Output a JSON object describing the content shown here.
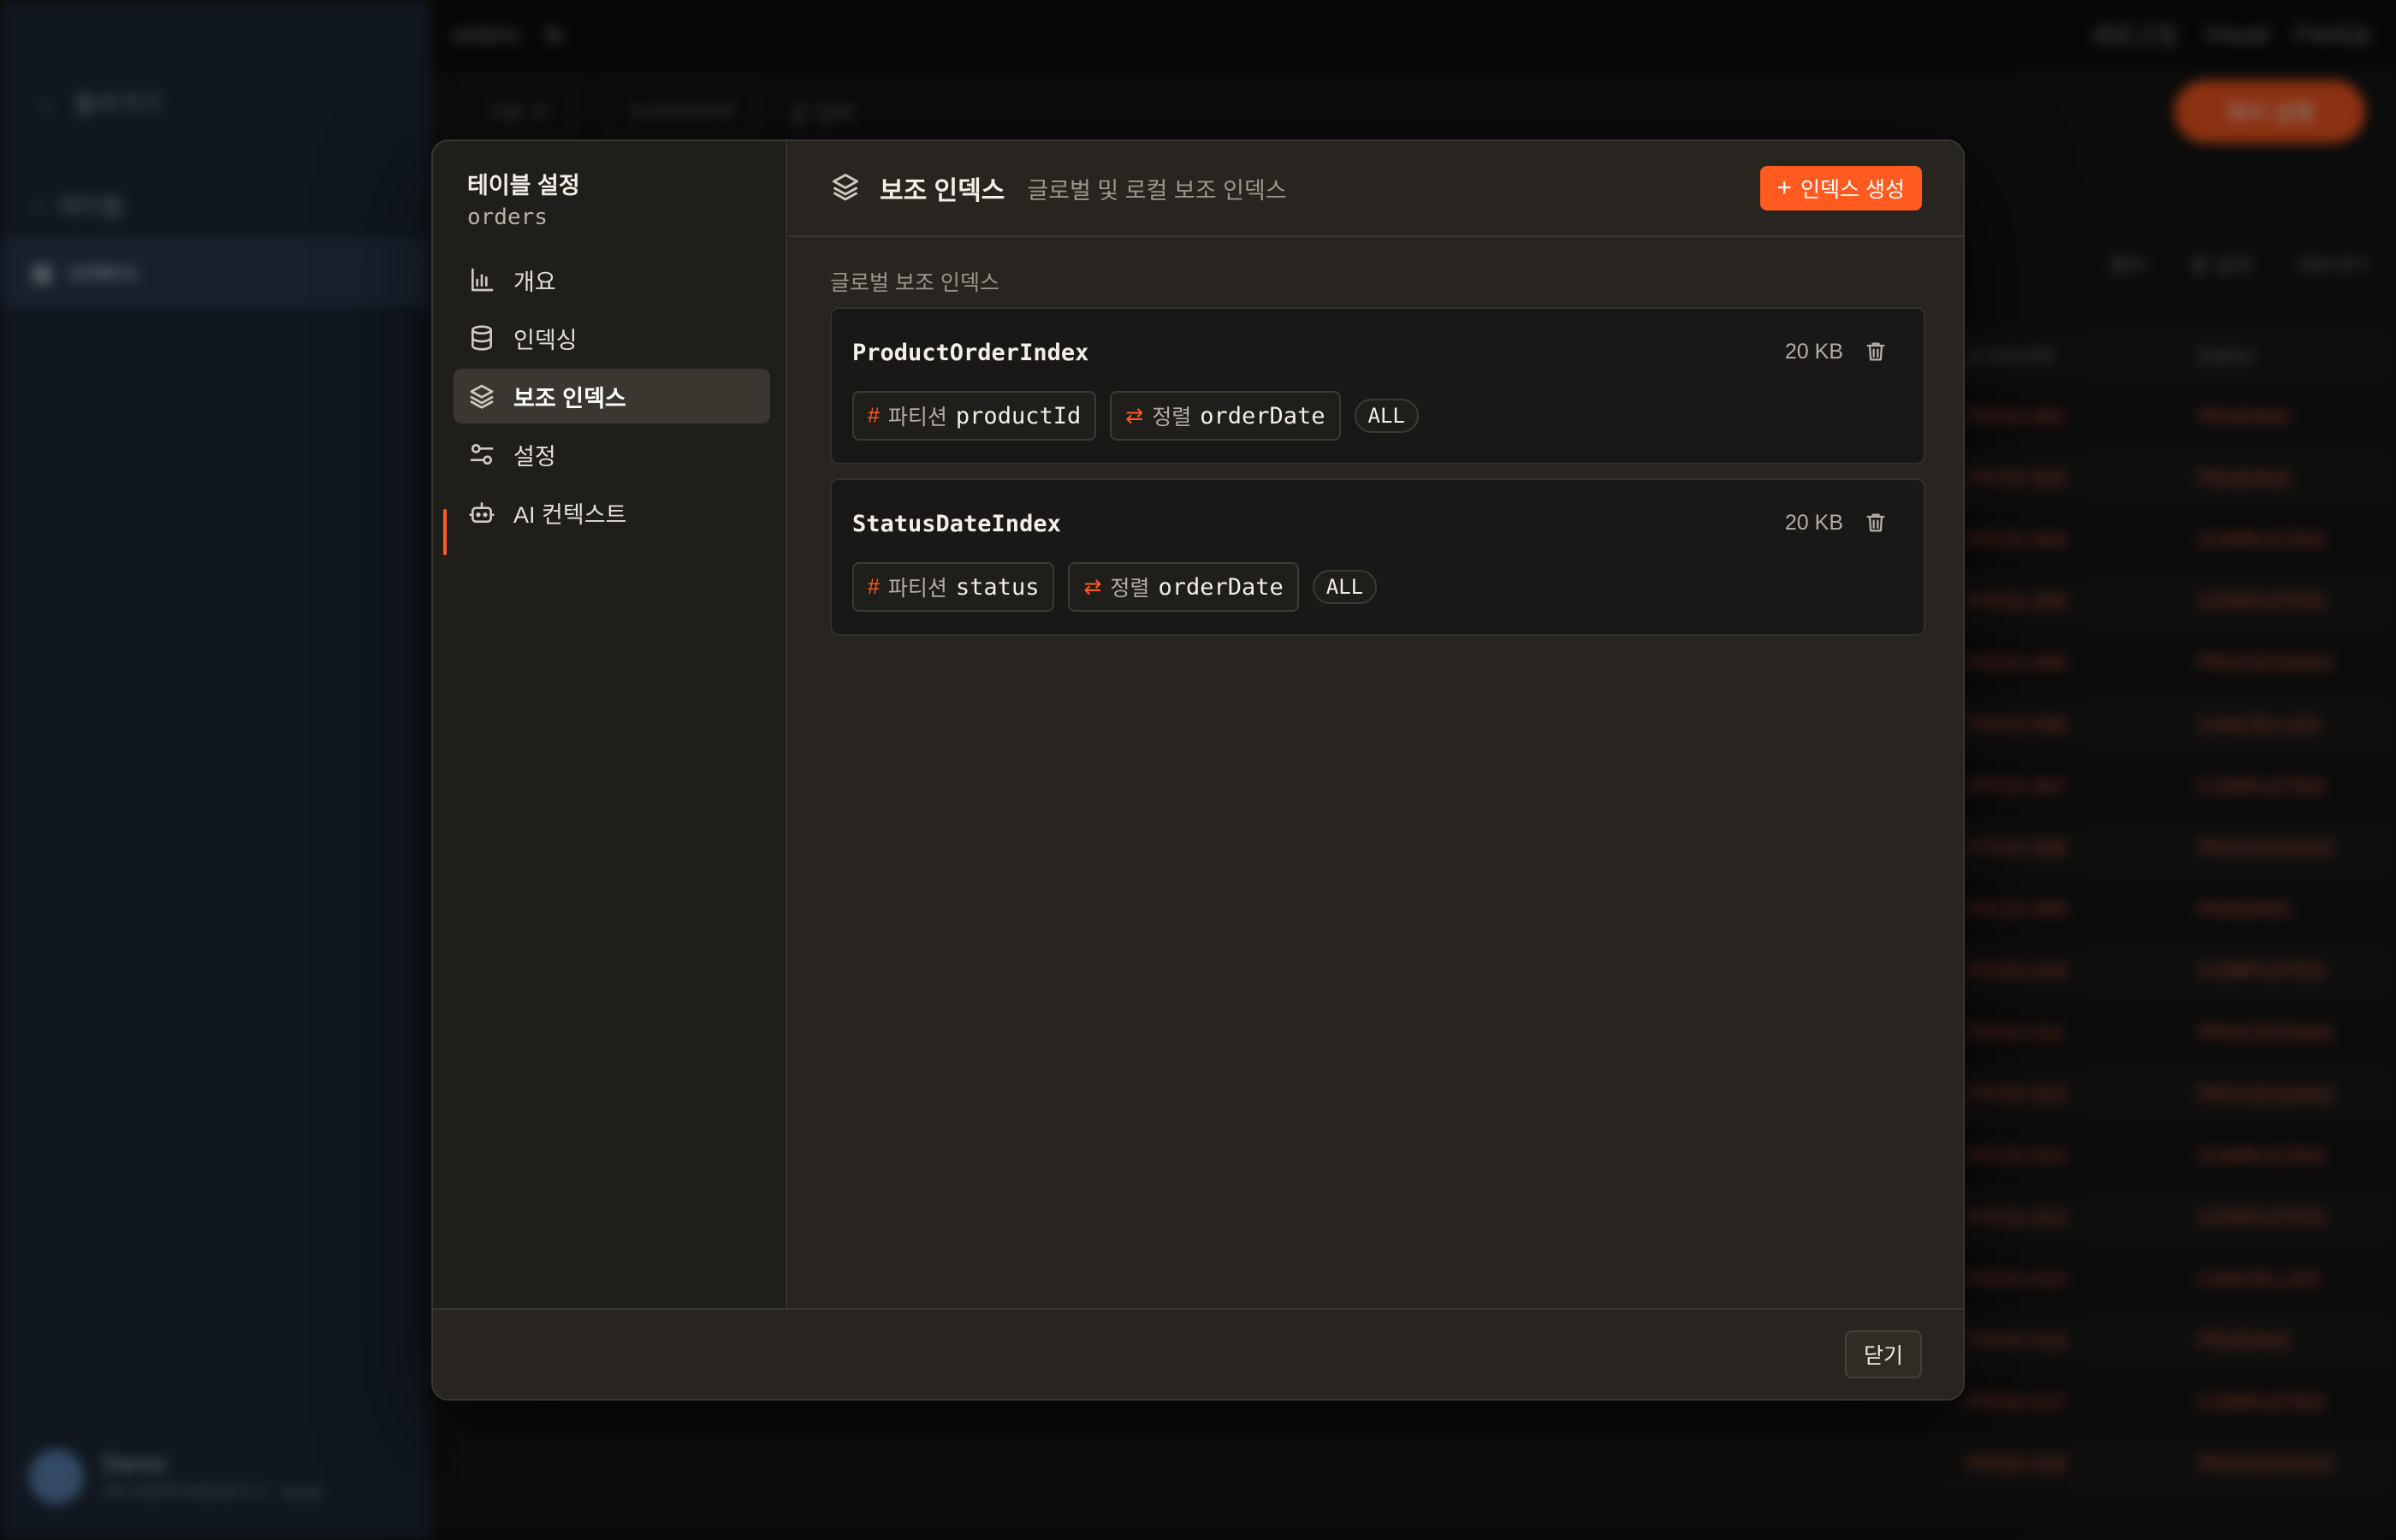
{
  "background": {
    "sidebar": {
      "back_label": "돌아가기",
      "section_label": "테이블",
      "active_table": "orders",
      "user_name": "Demo",
      "user_sub": "AP-NORTHEAST-2 · local"
    },
    "topbar": {
      "table_name": "orders",
      "right_items": [
        "새로고침",
        "Visual",
        "PartiQL"
      ]
    },
    "toolbar": {
      "mode": "기본 키",
      "pk_field": "customerId",
      "pk_placeholder": "값 입력",
      "run_label": "쿼리 실행"
    },
    "actions": [
      "필터",
      "열 설정",
      "내보내기"
    ],
    "columns": [
      "productId",
      "status"
    ],
    "rows": [
      {
        "pid": "PROD-001",
        "status": "PENDING"
      },
      {
        "pid": "PROD-002",
        "status": "PENDING"
      },
      {
        "pid": "PROD-003",
        "status": "COMPLETED"
      },
      {
        "pid": "PROD-004",
        "status": "COMPLETED"
      },
      {
        "pid": "PROD-005",
        "status": "PROCESSING"
      },
      {
        "pid": "PROD-006",
        "status": "CANCELLED"
      },
      {
        "pid": "PROD-007",
        "status": "COMPLETED"
      },
      {
        "pid": "PROD-008",
        "status": "PROCESSING"
      },
      {
        "pid": "PROD-009",
        "status": "PENDING"
      },
      {
        "pid": "PROD-010",
        "status": "COMPLETED"
      },
      {
        "pid": "PROD-011",
        "status": "PROCESSING"
      },
      {
        "pid": "PROD-012",
        "status": "PROCESSING"
      },
      {
        "pid": "PROD-013",
        "status": "COMPLETED"
      },
      {
        "pid": "PROD-014",
        "status": "COMPLETED"
      },
      {
        "pid": "PROD-015",
        "status": "CANCELLED"
      },
      {
        "pid": "PROD-016",
        "status": "PENDING"
      },
      {
        "pid": "PROD-017",
        "status": "COMPLETED"
      },
      {
        "pid": "PROD-018",
        "status": "PROCESSING"
      }
    ]
  },
  "modal": {
    "title": "테이블 설정",
    "subtitle": "orders",
    "nav": [
      {
        "label": "개요",
        "icon": "bar-chart-icon"
      },
      {
        "label": "인덱싱",
        "icon": "database-icon"
      },
      {
        "label": "보조 인덱스",
        "icon": "layers-icon",
        "active": true
      },
      {
        "label": "설정",
        "icon": "sliders-icon"
      },
      {
        "label": "AI 컨텍스트",
        "icon": "bot-icon"
      }
    ],
    "panel": {
      "title": "보조 인덱스",
      "description": "글로벌 및 로컬 보조 인덱스",
      "create_button": "인덱스 생성",
      "section_label": "글로벌 보조 인덱스",
      "indexes": [
        {
          "name": "ProductOrderIndex",
          "size": "20 KB",
          "partition_label": "파티션",
          "partition_key": "productId",
          "sort_label": "정렬",
          "sort_key": "orderDate",
          "projection": "ALL"
        },
        {
          "name": "StatusDateIndex",
          "size": "20 KB",
          "partition_label": "파티션",
          "partition_key": "status",
          "sort_label": "정렬",
          "sort_key": "orderDate",
          "projection": "ALL"
        }
      ]
    },
    "close_button": "닫기"
  },
  "colors": {
    "accent": "#ff5a1f",
    "modal_bg": "#282520",
    "sidebar_bg": "#201e1a",
    "card_bg": "#1a1816"
  }
}
